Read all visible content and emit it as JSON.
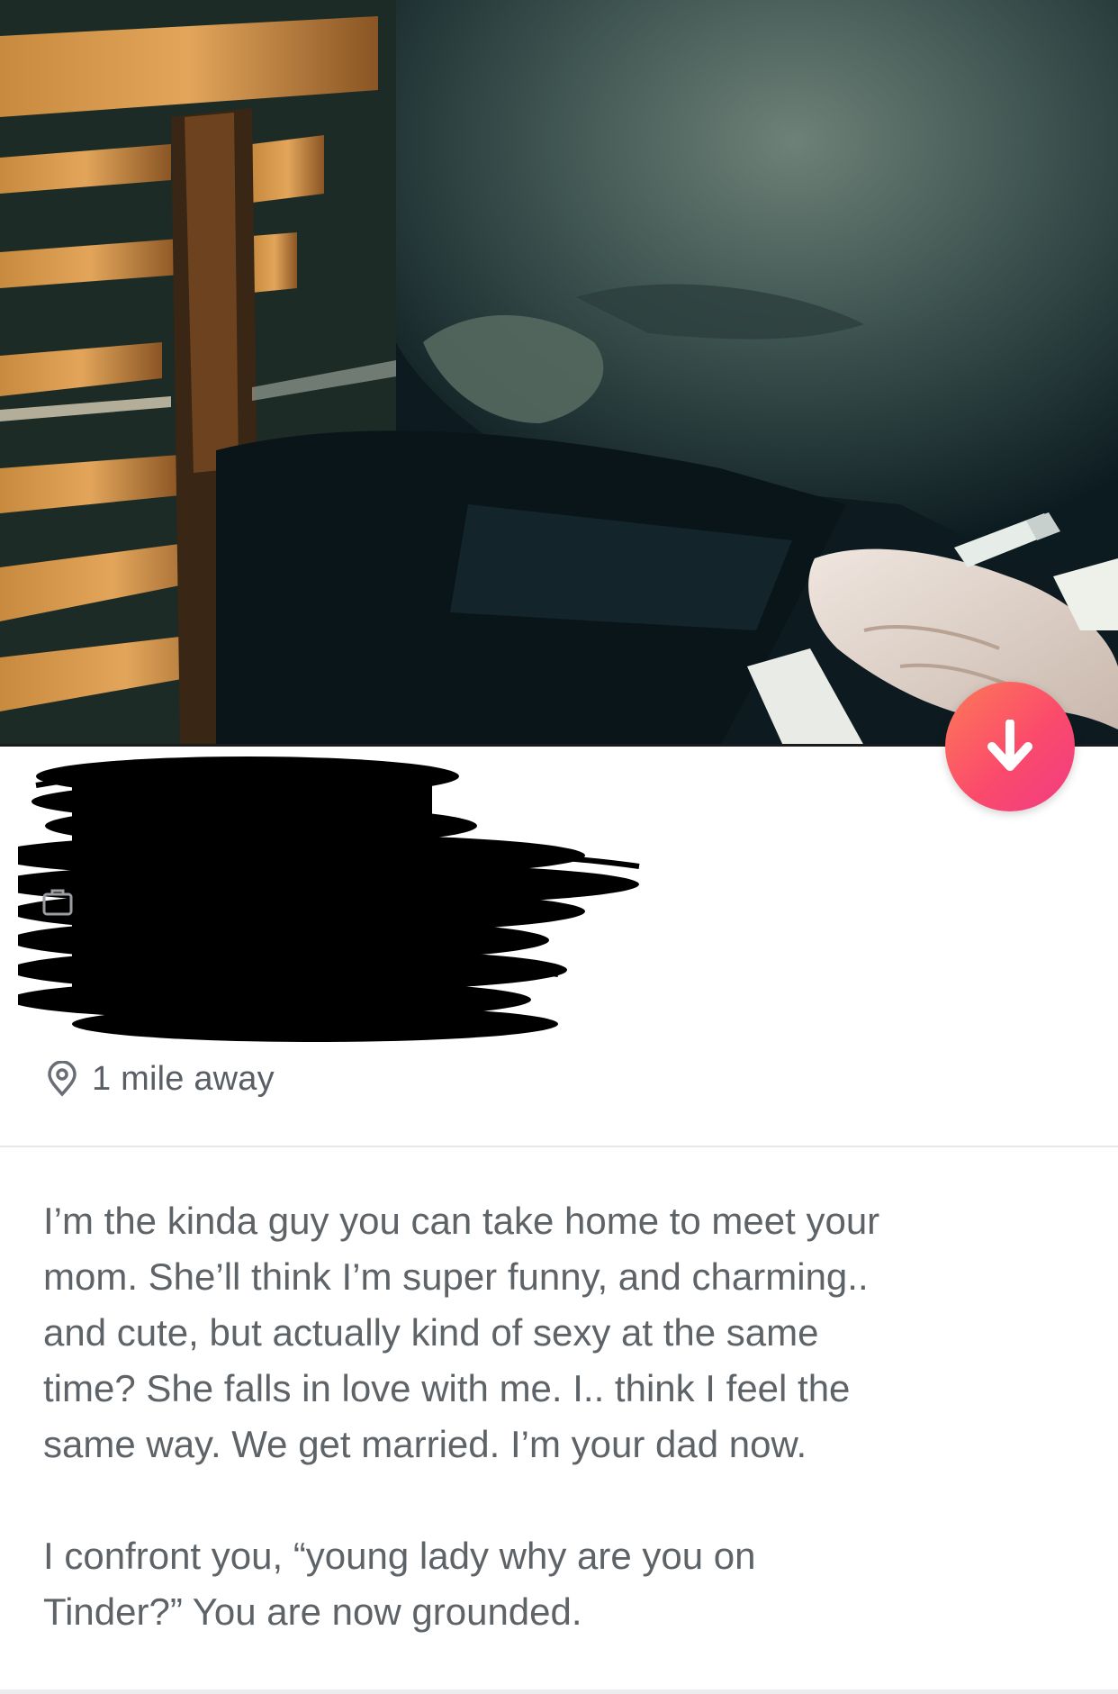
{
  "profile": {
    "photo_icon": "profile-photo",
    "info_button_icon": "arrow-down-icon",
    "redaction": "name-age-job-redacted",
    "job_icon": "briefcase-icon",
    "distance": {
      "icon": "location-pin-icon",
      "label": "1 mile away"
    },
    "bio": [
      "I’m the kinda guy you can take home to meet your\nmom. She’ll think I’m super funny, and charming..\nand cute, but actually kind of sexy at the same\ntime? She falls in love with me. I.. think I feel the\nsame way. We get married. I’m your dad now.",
      "I confront you, “young lady why are you on\nTinder?” You are now grounded."
    ]
  },
  "colors": {
    "accent_gradient_start": "#fd7a58",
    "accent_gradient_end": "#f13b83",
    "text_secondary": "#5e6368",
    "divider": "#e7e7e9"
  }
}
